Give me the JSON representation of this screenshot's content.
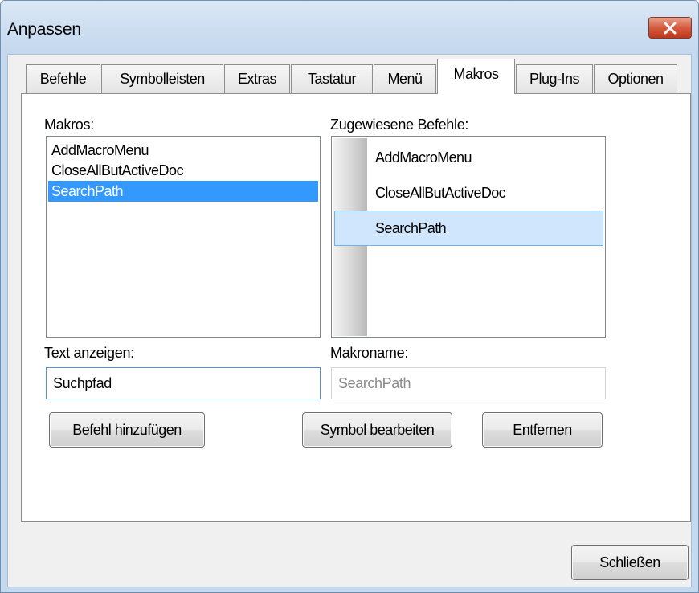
{
  "window": {
    "title": "Anpassen",
    "close_icon": "close-x-icon"
  },
  "tabs": [
    {
      "label": "Befehle",
      "active": false
    },
    {
      "label": "Symbolleisten",
      "active": false
    },
    {
      "label": "Extras",
      "active": false
    },
    {
      "label": "Tastatur",
      "active": false
    },
    {
      "label": "Menü",
      "active": false
    },
    {
      "label": "Makros",
      "active": true
    },
    {
      "label": "Plug-Ins",
      "active": false
    },
    {
      "label": "Optionen",
      "active": false
    }
  ],
  "macros": {
    "label": "Makros:",
    "items": [
      "AddMacroMenu",
      "CloseAllButActiveDoc",
      "SearchPath"
    ],
    "selected": "SearchPath"
  },
  "assigned": {
    "label": "Zugewiesene Befehle:",
    "items": [
      "AddMacroMenu",
      "CloseAllButActiveDoc",
      "SearchPath"
    ],
    "selected": "SearchPath"
  },
  "display_text": {
    "label": "Text anzeigen:",
    "value": "Suchpfad"
  },
  "macro_name": {
    "label": "Makroname:",
    "value": "SearchPath"
  },
  "buttons": {
    "add_command": "Befehl hinzufügen",
    "edit_icon": "Symbol bearbeiten",
    "remove": "Entfernen",
    "close": "Schließen"
  },
  "colors": {
    "selection": "#3399ff",
    "menu_highlight": "#cfe6fc",
    "close_button": "#c0371c"
  }
}
